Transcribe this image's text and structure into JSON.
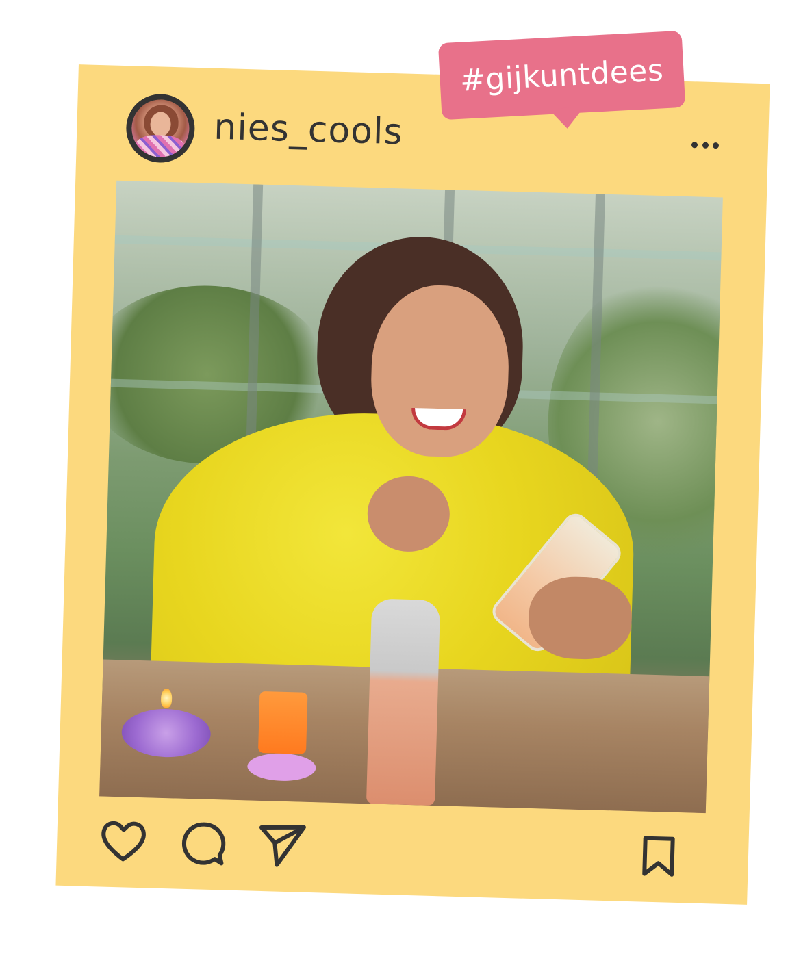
{
  "post": {
    "username": "nies_cools",
    "hashtag": "#gijkuntdees"
  },
  "icons": {
    "more": "more-options-icon",
    "like": "heart-icon",
    "comment": "comment-icon",
    "share": "send-icon",
    "save": "bookmark-icon"
  },
  "colors": {
    "frame": "#fcd97e",
    "tag": "#e8718a",
    "ink": "#333333",
    "tag_text": "#ffffff"
  }
}
